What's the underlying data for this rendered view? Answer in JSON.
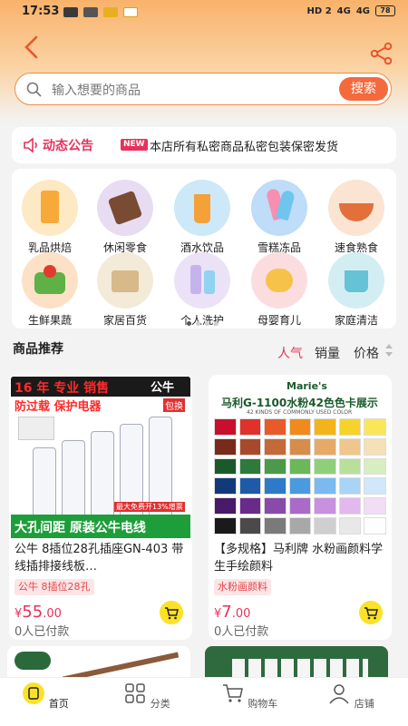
{
  "status": {
    "time": "17:53",
    "net": "HD 2",
    "sig1": "4G",
    "sig2": "4G",
    "battery": "78"
  },
  "search": {
    "placeholder": "输入想要的商品",
    "button": "搜索"
  },
  "notice": {
    "title": "动态公告",
    "badge": "NEW",
    "text": "本店所有私密商品私密包装保密发货"
  },
  "categories": [
    {
      "label": "乳品烘焙",
      "color": "#fbc36b"
    },
    {
      "label": "休闲零食",
      "color": "#b8a2d8"
    },
    {
      "label": "酒水饮品",
      "color": "#8fc9ef"
    },
    {
      "label": "雪糕冻品",
      "color": "#6fb2ee"
    },
    {
      "label": "速食熟食",
      "color": "#f4c9a8"
    },
    {
      "label": "生鲜果蔬",
      "color": "#f7b46a"
    },
    {
      "label": "家居百货",
      "color": "#e9d9b8"
    },
    {
      "label": "个人洗护",
      "color": "#d8c7ee"
    },
    {
      "label": "母婴育儿",
      "color": "#f4c3c8"
    },
    {
      "label": "家庭清洁",
      "color": "#a8dde8"
    }
  ],
  "recommend": {
    "title": "商品推荐",
    "sort": [
      "人气",
      "销量",
      "价格"
    ]
  },
  "products": [
    {
      "name": "公牛 8插位28孔插座GN-403 带线插排接线板…",
      "tag": "公牛 8插位28孔",
      "currency": "¥",
      "price_int": "55",
      "price_dec": ".00",
      "sold": "0人已付款",
      "banner1": "16 年 专业 销售",
      "banner2": "防过载 保护电器",
      "brand": "公牛",
      "badge": "包换",
      "bottom": "大孔间距  原装公牛电线",
      "sticker": "最大免费开13%增票"
    },
    {
      "name": "【多规格】马利牌 水粉画颜料学生手绘颜料",
      "tag": "水粉画颜料",
      "currency": "¥",
      "price_int": "7",
      "price_dec": ".00",
      "sold": "0人已付款",
      "brand": "Marie's",
      "title": "马利G-1100水粉42色色卡展示",
      "subtitle": "42 KINDS OF COMMONLY USED COLOR"
    }
  ],
  "tabs": [
    {
      "label": "首页"
    },
    {
      "label": "分类"
    },
    {
      "label": "购物车"
    },
    {
      "label": "店铺"
    }
  ],
  "colors": {
    "accent": "#e6325c",
    "search_border": "#f08a46",
    "search_btn": "#f56a3d",
    "cart": "#fbe229"
  }
}
